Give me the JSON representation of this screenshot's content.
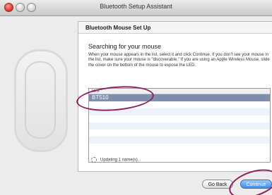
{
  "window": {
    "title": "Bluetooth Setup Assistant"
  },
  "panel": {
    "header": "Bluetooth Mouse Set Up",
    "heading": "Searching for your mouse",
    "description": "When your mouse appears in the list, select it and click Continue. If you don't see your mouse in the list, make sure your mouse is \"discoverable.\" If you are using an Apple Wireless Mouse, slide the cover on the bottom of the mouse to expose the LED."
  },
  "device_list": {
    "column_header": "Mice",
    "rows": [
      "BT510",
      "",
      "",
      "",
      "",
      "",
      "",
      ""
    ],
    "selected_index": 0
  },
  "status": {
    "text": "Updating 1 name(s)..."
  },
  "buttons": {
    "back": "Go Back",
    "continue": "Continue"
  },
  "colors": {
    "accent": "#3f8ee8",
    "selection": "#7f8fab",
    "callout": "#8c1f5e"
  }
}
